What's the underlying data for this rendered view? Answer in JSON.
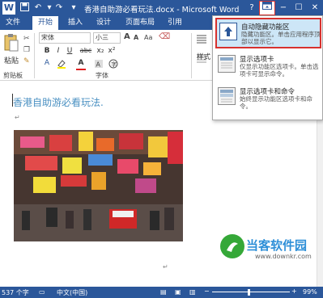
{
  "title_bar": {
    "word_logo": "W",
    "doc_title": "香港自助游必看玩法.docx - Microsoft Word",
    "help": "?",
    "ribbon_display_options": "▣",
    "minimize": "−",
    "maximize": "☐",
    "close": "✕",
    "qat_save": "💾",
    "qat_undo": "↶",
    "qat_redo": "↷",
    "qat_customize": "▾"
  },
  "ribbon_tabs": [
    {
      "label": "文件"
    },
    {
      "label": "开始"
    },
    {
      "label": "插入"
    },
    {
      "label": "设计"
    },
    {
      "label": "页面布局"
    },
    {
      "label": "引用"
    }
  ],
  "ribbon": {
    "paste_label": "粘贴",
    "clipboard_group": "剪贴板",
    "font_group": "字体",
    "font_name": "宋体",
    "font_size": "小三",
    "style_label": "样式",
    "bold": "B",
    "italic": "I",
    "underline": "U",
    "strike": "abc",
    "subscript": "x₂",
    "superscript": "x²",
    "font_color": "A",
    "grow": "A",
    "shrink": "A",
    "clear_format": "Aa"
  },
  "dropdown": {
    "items": [
      {
        "title": "自动隐藏功能区",
        "desc": "隐藏功能区。单击应用程序顶部以显示它。"
      },
      {
        "title": "显示选项卡",
        "desc": "仅显示功能区选项卡。单击选项卡可显示命令。"
      },
      {
        "title": "显示选项卡和命令",
        "desc": "始终显示功能区选项卡和命令。"
      }
    ]
  },
  "document": {
    "heading": "香港自助游必看玩法.",
    "para_mark": "↵"
  },
  "status_bar": {
    "word_count": "537 个字",
    "language": "中文(中国)",
    "zoom": "99%"
  },
  "watermark": {
    "brand": "当客软件园",
    "url": "www.downkr.com"
  },
  "colors": {
    "word_blue": "#2b579a",
    "highlight_red": "#d7312e",
    "dropdown_hover": "#cde6f7",
    "heading_text": "#4a90c2"
  }
}
